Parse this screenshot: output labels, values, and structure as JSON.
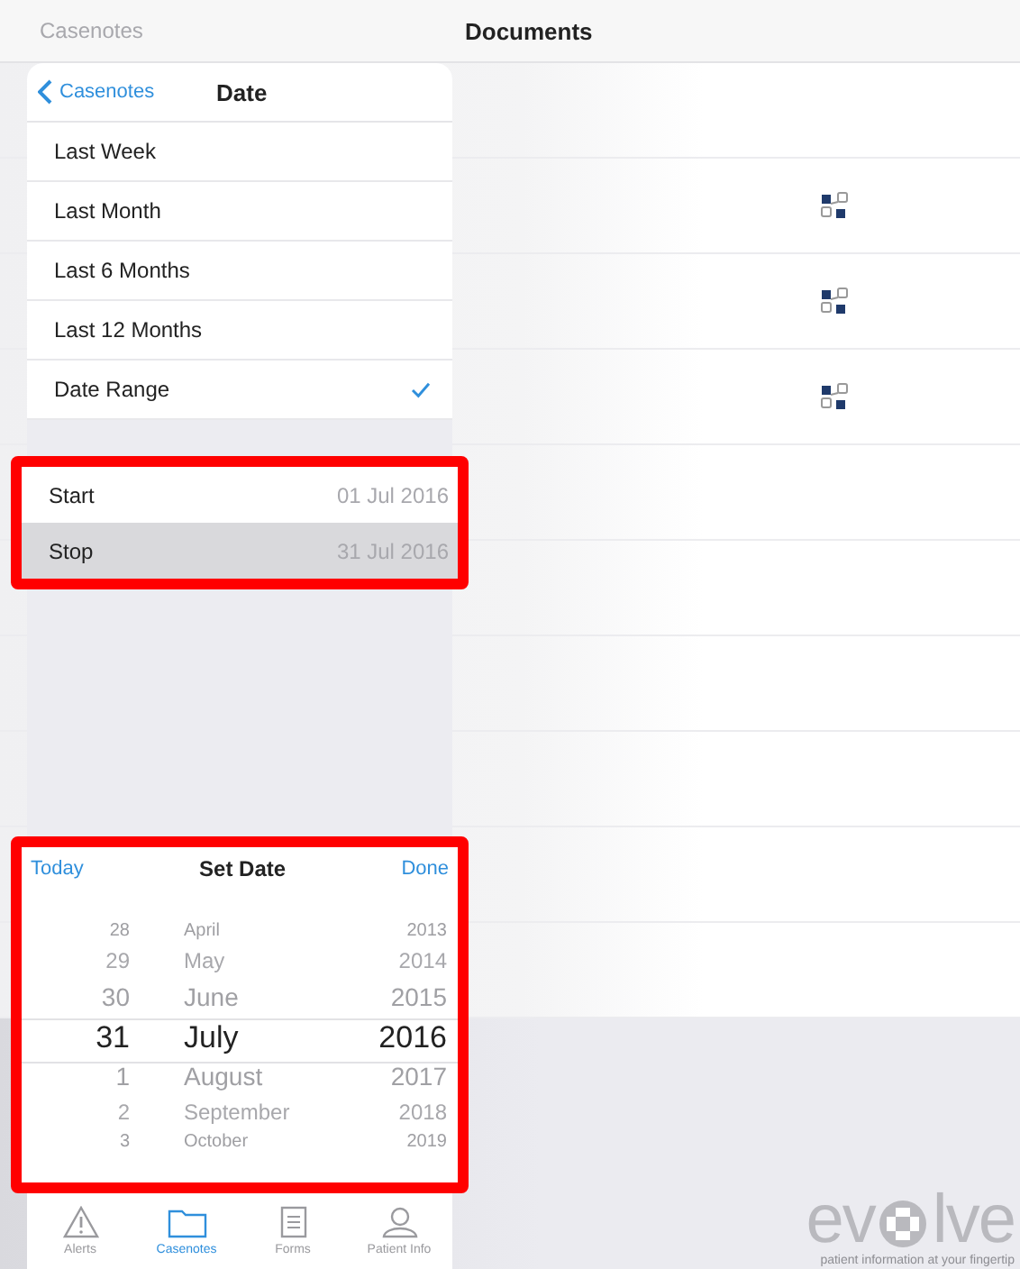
{
  "top_bar": {
    "back_label": "Casenotes",
    "title": "Documents"
  },
  "documents": {
    "rows": [
      {
        "kind": "empty"
      },
      {
        "kind": "linked"
      },
      {
        "kind": "linked"
      },
      {
        "kind": "linked"
      },
      {
        "kind": "empty"
      },
      {
        "kind": "empty"
      },
      {
        "kind": "empty"
      },
      {
        "kind": "empty"
      },
      {
        "kind": "empty"
      },
      {
        "kind": "empty"
      }
    ]
  },
  "logo": {
    "left": "ev",
    "right": "lve",
    "tagline": "patient information at your fingertip"
  },
  "popover": {
    "back_label": "Casenotes",
    "title": "Date",
    "options": [
      {
        "label": "Last Week",
        "checked": false
      },
      {
        "label": "Last Month",
        "checked": false
      },
      {
        "label": "Last 6 Months",
        "checked": false
      },
      {
        "label": "Last 12 Months",
        "checked": false
      },
      {
        "label": "Date Range",
        "checked": true
      }
    ],
    "range": [
      {
        "label": "Start",
        "value": "01 Jul 2016",
        "selected": false
      },
      {
        "label": "Stop",
        "value": "31 Jul 2016",
        "selected": true
      }
    ],
    "picker": {
      "left_button": "Today",
      "title": "Set Date",
      "right_button": "Done",
      "days": [
        {
          "text": "28",
          "selected": false
        },
        {
          "text": "29",
          "selected": false
        },
        {
          "text": "30",
          "selected": false
        },
        {
          "text": "31",
          "selected": true
        },
        {
          "text": "1",
          "selected": false
        },
        {
          "text": "2",
          "selected": false
        },
        {
          "text": "3",
          "selected": false
        }
      ],
      "months": [
        {
          "text": "April",
          "selected": false
        },
        {
          "text": "May",
          "selected": false
        },
        {
          "text": "June",
          "selected": false
        },
        {
          "text": "July",
          "selected": true
        },
        {
          "text": "August",
          "selected": false
        },
        {
          "text": "September",
          "selected": false
        },
        {
          "text": "October",
          "selected": false
        }
      ],
      "years": [
        {
          "text": "2013",
          "selected": false
        },
        {
          "text": "2014",
          "selected": false
        },
        {
          "text": "2015",
          "selected": false
        },
        {
          "text": "2016",
          "selected": true
        },
        {
          "text": "2017",
          "selected": false
        },
        {
          "text": "2018",
          "selected": false
        },
        {
          "text": "2019",
          "selected": false
        }
      ]
    }
  },
  "tabs": [
    {
      "label": "Alerts",
      "kind": "alert",
      "selected": false
    },
    {
      "label": "Casenotes",
      "kind": "folder",
      "selected": true
    },
    {
      "label": "Forms",
      "kind": "form",
      "selected": false
    },
    {
      "label": "Patient Info",
      "kind": "person",
      "selected": false
    }
  ]
}
